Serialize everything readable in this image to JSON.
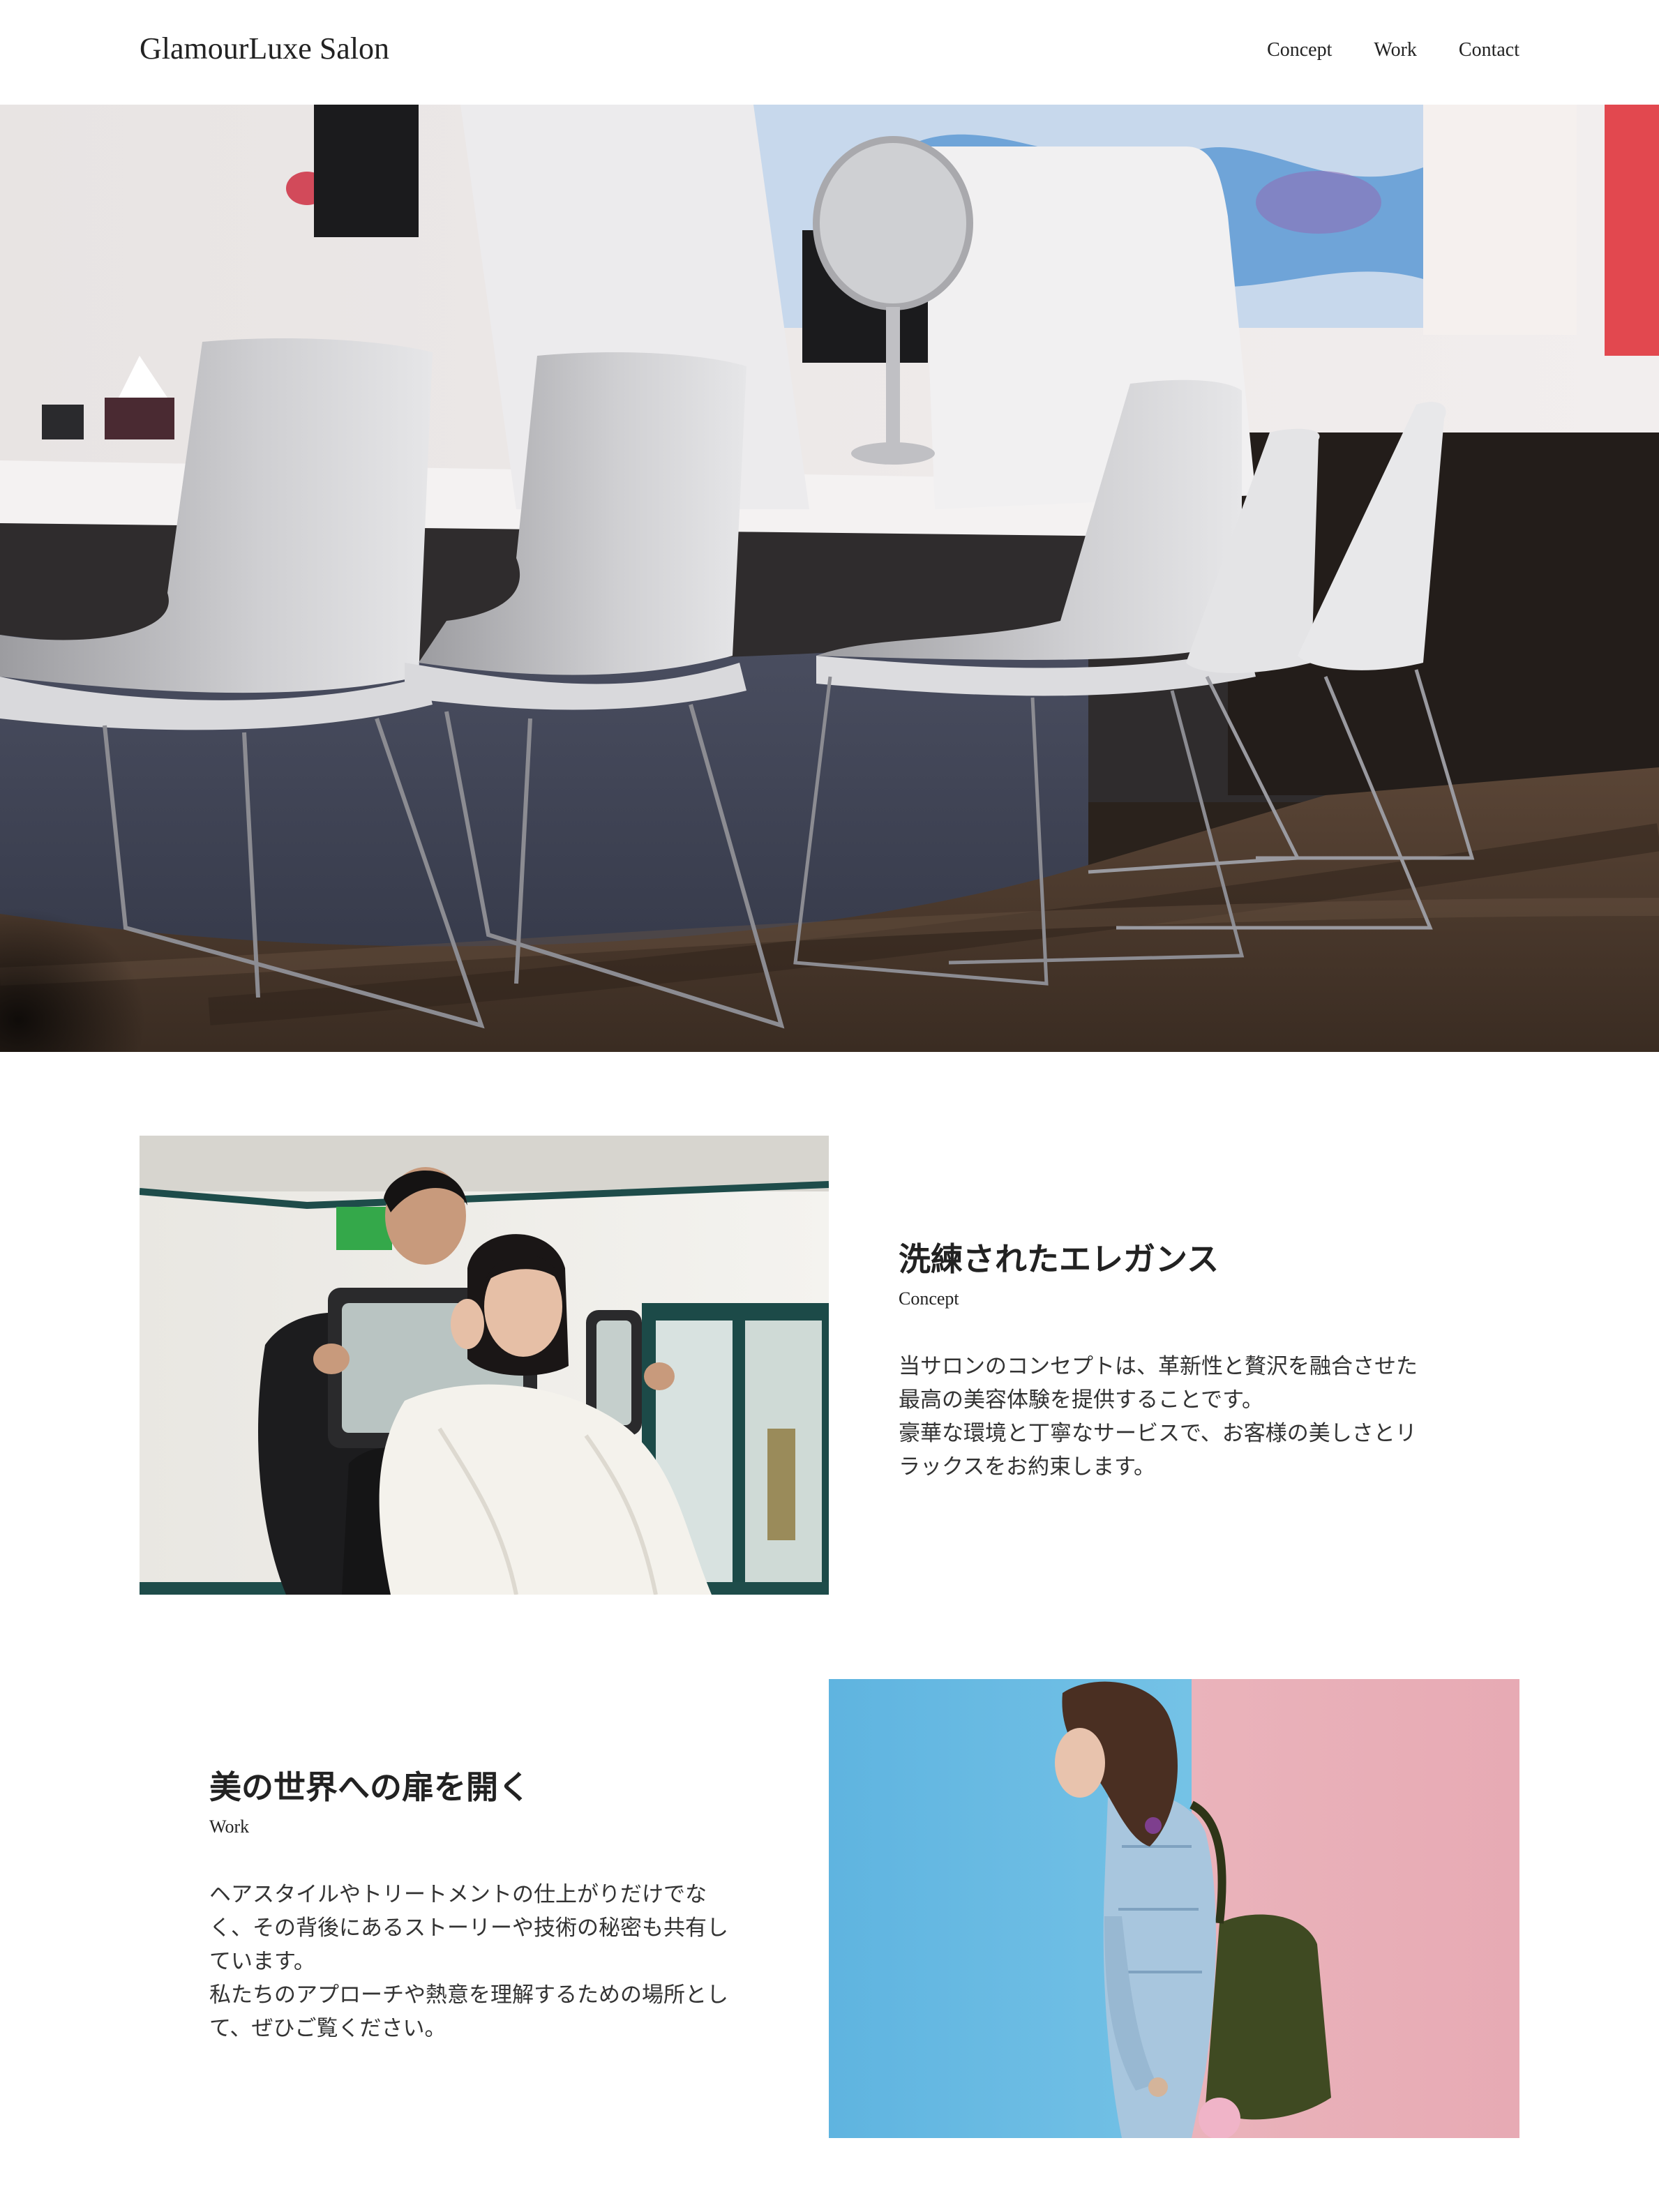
{
  "header": {
    "brand": "GlamourLuxe Salon",
    "nav": [
      {
        "label": "Concept"
      },
      {
        "label": "Work"
      },
      {
        "label": "Contact"
      }
    ]
  },
  "hero": {
    "image": "salon-interior-photo"
  },
  "concept": {
    "image": "stylist-with-client-mirror-photo",
    "heading": "洗練されたエレガンス",
    "label": "Concept",
    "body_lines": [
      "当サロンのコンセプトは、革新性と贅沢を融合させた",
      "最高の美容体験を提供することです。",
      "豪華な環境と丁寧なサービスで、お客様の美しさとリ",
      "ラックスをお約束します。"
    ]
  },
  "work": {
    "image": "woman-against-blue-pink-wall-photo",
    "heading": "美の世界への扉を開く",
    "label": "Work",
    "body_lines": [
      "ヘアスタイルやトリートメントの仕上がりだけでな",
      "く、その背後にあるストーリーや技術の秘密も共有し",
      "ています。",
      "私たちのアプローチや熱意を理解するための場所とし",
      "て、ぜひご覧ください。"
    ]
  }
}
